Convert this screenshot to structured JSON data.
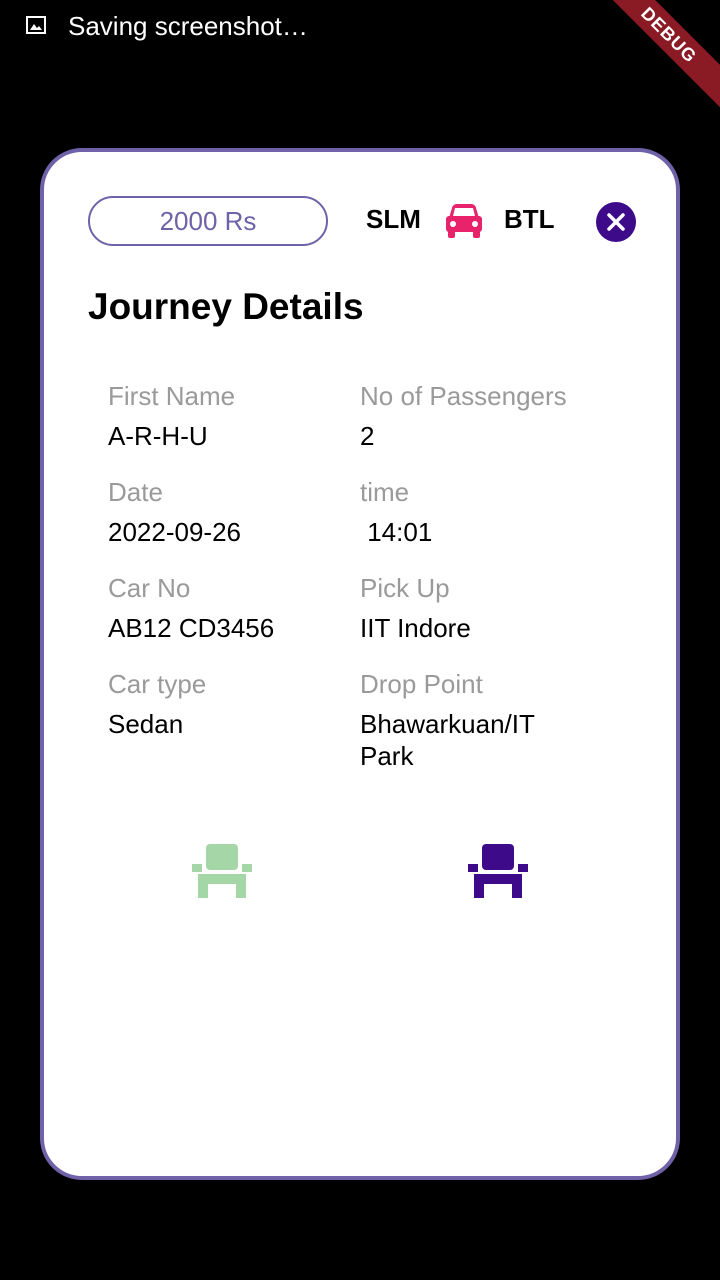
{
  "status_bar": {
    "text": "Saving screenshot…",
    "icon": "image-icon"
  },
  "debug_banner": {
    "label": "DEBUG",
    "color": "#8a1a24"
  },
  "card": {
    "price": "2000 Rs",
    "route": {
      "from": "SLM",
      "to": "BTL",
      "icon": "car-icon",
      "icon_color": "#e8226b"
    },
    "close_icon": "close-icon",
    "title": "Journey Details",
    "fields": [
      {
        "label": "First Name",
        "value": "A-R-H-U"
      },
      {
        "label": "No of Passengers",
        "value": "2"
      },
      {
        "label": "Date",
        "value": "2022-09-26"
      },
      {
        "label": "time",
        "value": " 14:01"
      },
      {
        "label": "Car No",
        "value": "AB12 CD3456"
      },
      {
        "label": "Pick Up",
        "value": "IIT Indore"
      },
      {
        "label": "Car type",
        "value": "Sedan"
      },
      {
        "label": "Drop Point",
        "value": "Bhawarkuan/IT Park"
      }
    ],
    "seats": [
      {
        "icon": "seat-icon",
        "state": "available",
        "color": "#a5d6a7"
      },
      {
        "icon": "seat-icon",
        "state": "booked",
        "color": "#3d0a8a"
      }
    ]
  },
  "colors": {
    "accent": "#6f62a8",
    "primary_dark": "#3d0a8a",
    "car_pink": "#e8226b",
    "seat_green": "#a5d6a7"
  }
}
